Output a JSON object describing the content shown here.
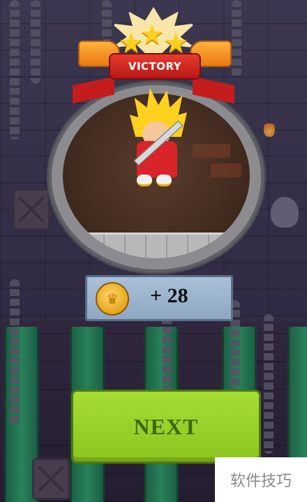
{
  "banner": {
    "title": "VICTORY"
  },
  "stars": {
    "count": 3,
    "glyph": "★"
  },
  "reward": {
    "icon": "coin-icon",
    "amount_text": "+ 28",
    "coin_symbol": "♛"
  },
  "actions": {
    "next_label": "NEXT"
  },
  "watermark": {
    "text": "软件技巧"
  },
  "colors": {
    "banner_red": "#d9252a",
    "button_green": "#9bd42b",
    "button_text": "#3b6a0a",
    "reward_panel": "#9fb6cf",
    "coin_gold": "#e6a51b"
  }
}
